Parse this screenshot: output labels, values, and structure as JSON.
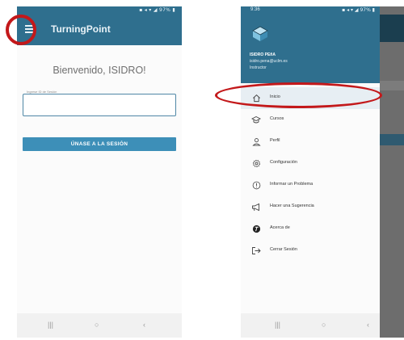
{
  "left_screen": {
    "status_icons": "▪ ◂ ▾ ◢ 97% ▮",
    "app_title": "TurningPoint",
    "welcome_text": "Bienvenido, ISIDRO!",
    "session_input": {
      "label": "Ingrese ID de Sesión",
      "value": ""
    },
    "join_button_label": "ÚNASE A LA SESIÓN",
    "nav": {
      "recent": "|||",
      "home": "○",
      "back": "‹"
    }
  },
  "right_screen": {
    "status_time": "9:36",
    "status_icons": "▪ ◂ ▾ ◢ 97% ▮",
    "user": {
      "name": "ISIDRO PEñA",
      "email": "isidro.pena@uclm.es",
      "role": "Instructor"
    },
    "menu_items": [
      {
        "label": "Inicio",
        "icon": "home-icon"
      },
      {
        "label": "Cursos",
        "icon": "graduation-cap-icon"
      },
      {
        "label": "Perfil",
        "icon": "person-icon"
      },
      {
        "label": "Configuración",
        "icon": "gear-icon"
      },
      {
        "label": "Informar un Problema",
        "icon": "alert-circle-icon"
      },
      {
        "label": "Hacer una Sugerencia",
        "icon": "megaphone-icon"
      },
      {
        "label": "Acerca de",
        "icon": "turningpoint-logo-icon"
      },
      {
        "label": "Cerrar Sesión",
        "icon": "logout-icon"
      }
    ],
    "nav": {
      "recent": "|||",
      "home": "○",
      "back": "‹"
    }
  },
  "colors": {
    "appbar": "#2f6f8e",
    "button": "#3d8fb8",
    "annotation": "#c3181a",
    "active_item": "#e7eef3"
  }
}
